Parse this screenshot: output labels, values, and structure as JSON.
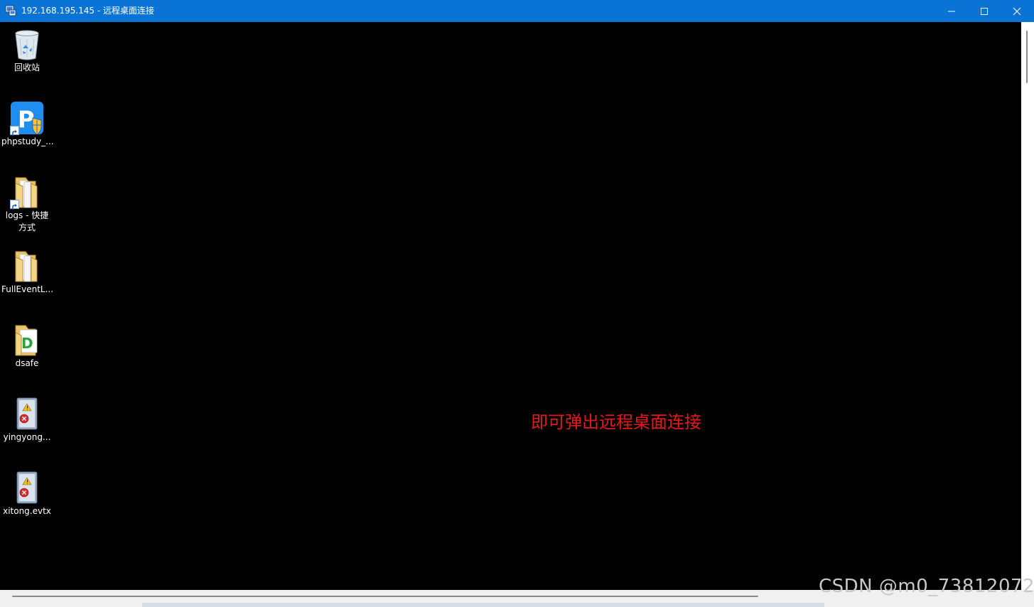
{
  "window": {
    "title": "192.168.195.145 - 远程桌面连接",
    "controls": {
      "minimize": "minimize-icon",
      "maximize": "maximize-icon",
      "close": "close-icon"
    }
  },
  "desktop": {
    "icons": [
      {
        "label": "回收站",
        "icon": "recycle-bin-icon"
      },
      {
        "label": "phpstudy_...",
        "icon": "phpstudy-shortcut-icon"
      },
      {
        "label": "logs - 快捷方式",
        "icon": "folder-shortcut-icon"
      },
      {
        "label": "FullEventL...",
        "icon": "folder-icon"
      },
      {
        "label": "dsafe",
        "icon": "dsafe-folder-icon"
      },
      {
        "label": "yingyong...",
        "icon": "event-log-file-icon"
      },
      {
        "label": "xitong.evtx",
        "icon": "event-log-file-icon"
      }
    ]
  },
  "annotation": {
    "text": "即可弹出远程桌面连接",
    "color": "#e81818"
  },
  "watermark": {
    "text": "CSDN @m0_73812072"
  },
  "colors": {
    "titlebar": "#0a74d6",
    "desktop": "#000000"
  }
}
